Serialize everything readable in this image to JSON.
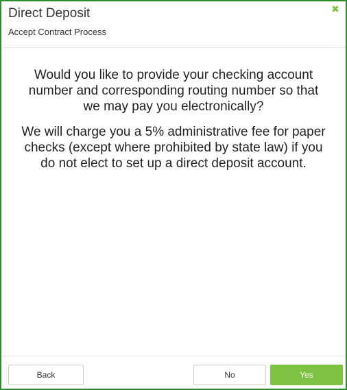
{
  "dialog": {
    "title": "Direct Deposit",
    "subtitle": "Accept Contract Process",
    "close_icon": "close-icon",
    "accent_color": "#7dc242",
    "border_color": "#2e8b2e"
  },
  "body": {
    "question": "Would you like to provide your checking account number and corresponding routing number so that we may pay you electronically?",
    "notice": "We will charge you a 5% administrative fee for paper checks (except where prohibited by state law) if you do not elect to set up a direct deposit account."
  },
  "footer": {
    "back_label": "Back",
    "no_label": "No",
    "yes_label": "Yes"
  }
}
